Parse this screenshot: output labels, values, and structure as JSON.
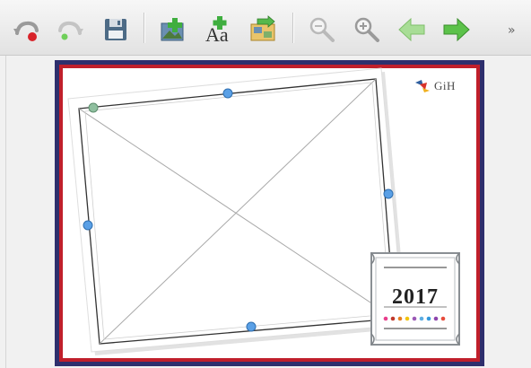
{
  "toolbar": {
    "buttons": [
      {
        "name": "undo-button",
        "icon": "undo-icon"
      },
      {
        "name": "redo-button",
        "icon": "redo-icon"
      },
      {
        "name": "save-button",
        "icon": "floppy-disk-icon"
      },
      {
        "name": "add-image-button",
        "icon": "add-image-icon"
      },
      {
        "name": "add-text-button",
        "icon": "add-text-icon"
      },
      {
        "name": "change-template-button",
        "icon": "template-swap-icon"
      },
      {
        "name": "zoom-out-button",
        "icon": "zoom-out-icon"
      },
      {
        "name": "zoom-in-button",
        "icon": "zoom-in-icon"
      },
      {
        "name": "previous-page-button",
        "icon": "arrow-left-icon"
      },
      {
        "name": "next-page-button",
        "icon": "arrow-right-icon"
      }
    ],
    "overflow_label": "»"
  },
  "canvas": {
    "logo_text": "GiH",
    "year": "2017",
    "colors": {
      "outer_border": "#2e2f6d",
      "inner_border": "#c01f2b",
      "handle": "#5aa0e6",
      "rotate_handle": "#8fbf9f"
    }
  }
}
